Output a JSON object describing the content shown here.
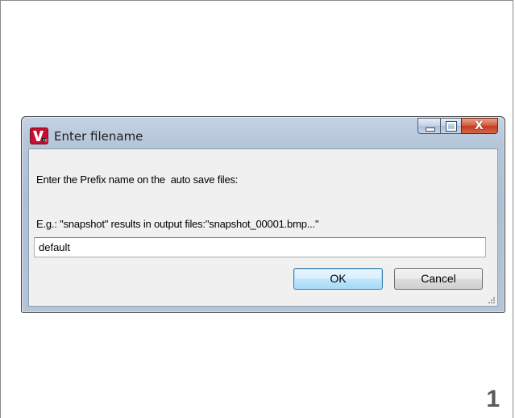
{
  "dialog": {
    "title": "Enter filename",
    "prompt_label": "Enter the Prefix name on the  auto save files:",
    "example_label": "E.g.: \"snapshot\" results in output files:\"snapshot_00001.bmp...\"",
    "filename_value": "default",
    "ok_label": "OK",
    "cancel_label": "Cancel",
    "caption_buttons": {
      "minimize_icon": "minimize-icon",
      "maximize_icon": "maximize-icon",
      "close_icon": "close-icon"
    }
  },
  "page": {
    "number": "1"
  },
  "colors": {
    "app_icon_bg": "#c8102e",
    "close_button": "#c23a1c",
    "default_button_border": "#3c7fb1"
  }
}
